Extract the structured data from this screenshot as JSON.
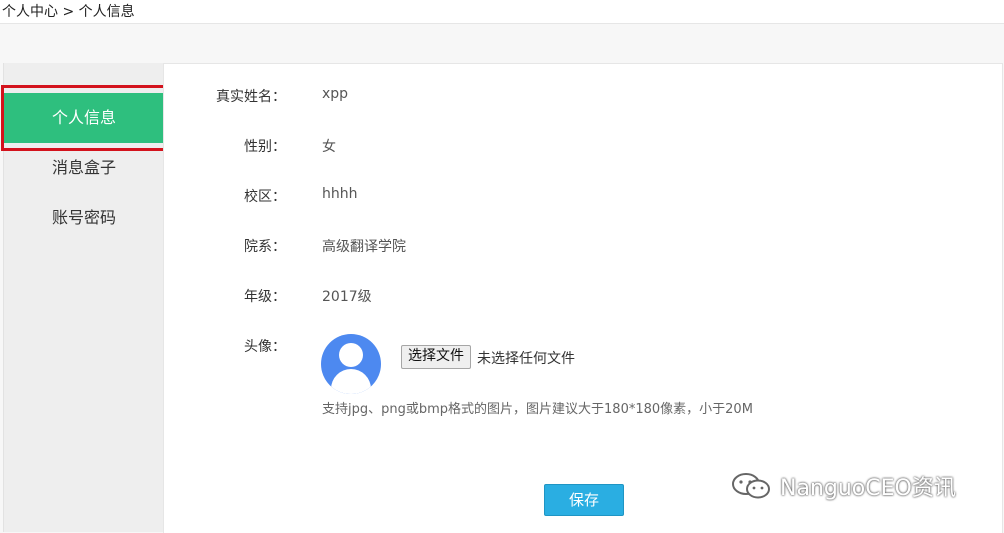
{
  "breadcrumb": "个人中心 > 个人信息",
  "sidebar": {
    "items": [
      {
        "label": "个人信息",
        "active": true
      },
      {
        "label": "消息盒子",
        "active": false
      },
      {
        "label": "账号密码",
        "active": false
      }
    ]
  },
  "form": {
    "real_name": {
      "label": "真实姓名：",
      "value": "xpp"
    },
    "gender": {
      "label": "性别：",
      "value": "女"
    },
    "campus": {
      "label": "校区：",
      "value": "hhhh"
    },
    "department": {
      "label": "院系：",
      "value": "高级翻译学院"
    },
    "grade": {
      "label": "年级：",
      "value": "2017级"
    },
    "avatar": {
      "label": "头像：",
      "choose_file_label": "选择文件",
      "file_status": "未选择任何文件",
      "hint": "支持jpg、png或bmp格式的图片，图片建议大于180*180像素，小于20M"
    },
    "save_label": "保存"
  },
  "watermark": "NanguoCEO资讯",
  "colors": {
    "active_nav": "#2ebf7e",
    "highlight_outline": "#d3121c",
    "save_button": "#2aaee2",
    "avatar": "#4d89f0"
  }
}
